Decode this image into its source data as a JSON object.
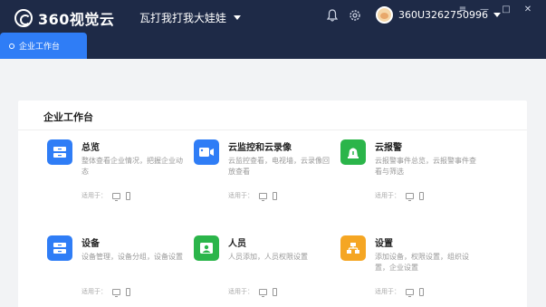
{
  "app": {
    "logo_text": "360视觉云"
  },
  "team": {
    "name": "瓦打我打我大娃娃"
  },
  "user": {
    "account": "360U3262750996"
  },
  "tab": {
    "label": "企业工作台"
  },
  "card": {
    "title": "企业工作台"
  },
  "usage_label": "适用于：",
  "features": [
    {
      "title": "总览",
      "desc": "整体查看企业情况，把握企业动态",
      "icon": "folder-icon",
      "color": "#2f7df6"
    },
    {
      "title": "云监控和云录像",
      "desc": "云监控查看，电视墙，云录像回放查看",
      "icon": "camera-icon",
      "color": "#2f7df6"
    },
    {
      "title": "云报警",
      "desc": "云报警事件总览，云报警事件查看与筛选",
      "icon": "alarm-icon",
      "color": "#2bb54a"
    },
    {
      "title": "设备",
      "desc": "设备管理，设备分组，设备设置",
      "icon": "device-icon",
      "color": "#2f7df6"
    },
    {
      "title": "人员",
      "desc": "人员添加，人员权限设置",
      "icon": "person-icon",
      "color": "#2bb54a"
    },
    {
      "title": "设置",
      "desc": "添加设备，权限设置，组织设置，企业设置",
      "icon": "settings-icon",
      "color": "#f5a623"
    }
  ],
  "window_controls": {
    "menu": "≡",
    "minimize": "—",
    "maximize": "□",
    "close": "✕"
  }
}
